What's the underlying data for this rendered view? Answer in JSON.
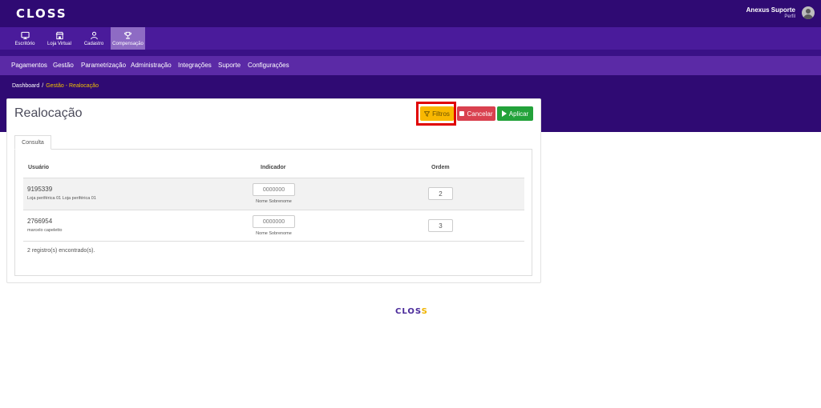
{
  "brand": {
    "logo_text": "CLOSS"
  },
  "user": {
    "name": "Anexus Suporte",
    "sub": "Perfil"
  },
  "modules": [
    {
      "label": "Escritório",
      "icon": "desktop-icon"
    },
    {
      "label": "Loja Virtual",
      "icon": "store-icon"
    },
    {
      "label": "Cadastro",
      "icon": "user-icon"
    },
    {
      "label": "Compensação",
      "icon": "trophy-icon",
      "active": true
    }
  ],
  "menu": [
    "Pagamentos",
    "Gestão",
    "Parametrização",
    "Administração",
    "Integrações",
    "Suporte",
    "Configurações"
  ],
  "breadcrumb": {
    "home": "Dashboard",
    "separator": "/",
    "current": "Gestão - Realocação"
  },
  "page": {
    "title": "Realocação"
  },
  "actions": {
    "filtros": "Filtros",
    "cancelar": "Cancelar",
    "aplicar": "Aplicar"
  },
  "tabs": [
    {
      "label": "Consulta"
    }
  ],
  "table": {
    "headers": {
      "usuario": "Usuário",
      "indicador": "Indicador",
      "ordem": "Ordem"
    },
    "rows": [
      {
        "id": "9195339",
        "name": "Loja periférica 01 Loja periférica 01",
        "indicador_placeholder": "0000000",
        "indicador_name": "Nome Sobrenome",
        "ordem": "2"
      },
      {
        "id": "2766954",
        "name": "marcelo capeletto",
        "indicador_placeholder": "0000000",
        "indicador_name": "Nome Sobrenome",
        "ordem": "3"
      }
    ],
    "count_text": "2 registro(s) encontrado(s)."
  },
  "footer": {
    "logo_part1": "CLOS",
    "logo_part2": "S"
  },
  "colors": {
    "primary_dark": "#2f0a73",
    "primary": "#4a1b9b",
    "menu": "#5b2aa6",
    "warning": "#f9b800",
    "danger": "#d9414f",
    "success": "#23a23a",
    "accent_text": "#f0c000"
  }
}
